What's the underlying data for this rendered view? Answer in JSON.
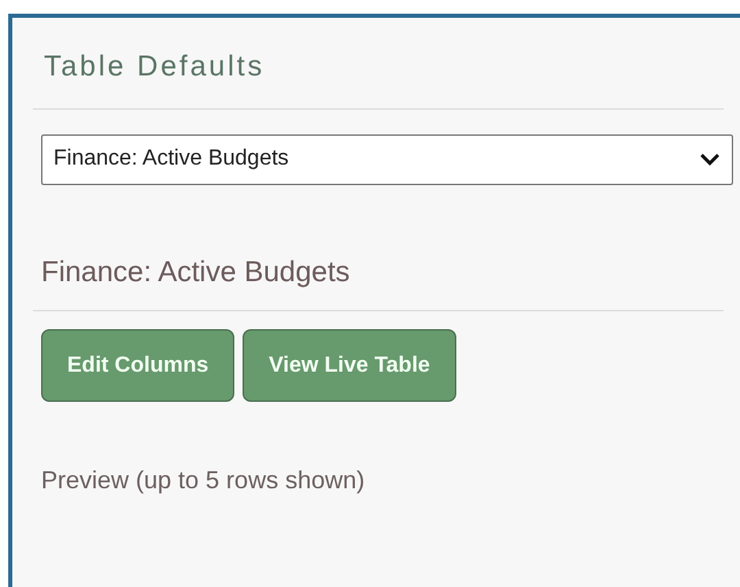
{
  "panel": {
    "title": "Table Defaults"
  },
  "table_select": {
    "value": "Finance: Active Budgets"
  },
  "section": {
    "title": "Finance: Active Budgets"
  },
  "buttons": [
    {
      "label": "Edit Columns"
    },
    {
      "label": "View Live Table"
    }
  ],
  "preview_note": "Preview (up to 5 rows shown)"
}
